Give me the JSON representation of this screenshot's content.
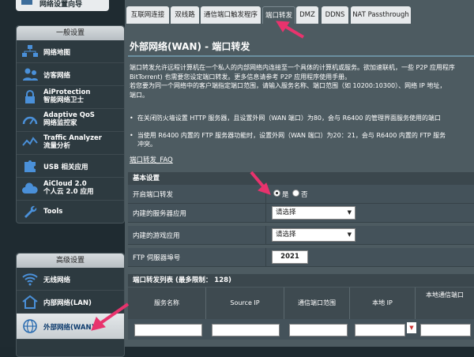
{
  "sidebar": {
    "top_item": "网络设置向导",
    "general_header": "一般设置",
    "general_items": [
      {
        "label": "网络地图",
        "icon": "network-map-icon"
      },
      {
        "label": "访客网络",
        "icon": "guest-network-icon"
      },
      {
        "label": "AiProtection",
        "label2": "智能网络卫士",
        "icon": "aiprotection-lock-icon"
      },
      {
        "label": "Adaptive QoS",
        "label2": "网络监控家",
        "icon": "qos-icon"
      },
      {
        "label": "Traffic Analyzer",
        "label2": "流量分析",
        "icon": "traffic-analyzer-icon"
      },
      {
        "label": "USB 相关应用",
        "icon": "usb-puzzle-icon"
      },
      {
        "label": "AiCloud 2.0",
        "label2": "个人云 2.0 应用",
        "icon": "aicloud-icon"
      },
      {
        "label": "Tools",
        "icon": "tools-wrench-icon"
      }
    ],
    "advanced_header": "高级设置",
    "advanced_items": [
      {
        "label": "无线网络",
        "icon": "wifi-icon"
      },
      {
        "label": "内部网络(LAN)",
        "icon": "home-icon"
      },
      {
        "label": "外部网络(WAN)",
        "icon": "globe-icon"
      }
    ]
  },
  "tabs": [
    "互联网连接",
    "双线路",
    "通信端口触发程序",
    "端口转发",
    "DMZ",
    "DDNS",
    "NAT Passthrough"
  ],
  "page": {
    "title": "外部网络(WAN) - 端口转发",
    "desc_lines": [
      "端口转发允许远程计算机在一个私人的内部网络内连接至一个具体的计算机或服务。欲加速联机，一些 P2P 应用程序",
      "BitTorrent) 也需要您设定端口转发。更多信息请参考 P2P 应用程序使用手册。",
      "若您要为同一个网络中的客户端指定端口范围，请输入服务名称、端口范围（如 10200:10300）、网络 IP 地址，",
      "端口。"
    ],
    "bullet1": "在关闭防火墙设置 HTTP 服务器，且设置外网（WAN 端口）为80，会与 R6400 的管理界面服务使用的端口",
    "bullet2_a": "当使用 R6400 内置的 FTP 服务器功能时，设置外网（WAN 端口）为20：21，会与 R6400 内置的 FTP 服务",
    "bullet2_b": "冲突。",
    "faq": "端口转发_FAQ"
  },
  "basic": {
    "header": "基本设置",
    "enable_label": "开启端口转发",
    "yes": "是",
    "no": "否",
    "server_label": "内建的服务器应用",
    "server_value": "请选择",
    "game_label": "内建的游戏应用",
    "game_value": "请选择",
    "ftp_label": "FTP 伺服器埠号",
    "ftp_value": "2021"
  },
  "list": {
    "header": "端口转发列表 (最多限制： 128)",
    "columns": [
      "服务名称",
      "Source IP",
      "通信端口范围",
      "本地 IP",
      "本地通信端口"
    ]
  },
  "colors": {
    "annotation_arrow": "#e8336d",
    "accent": "#6b8fa0"
  }
}
